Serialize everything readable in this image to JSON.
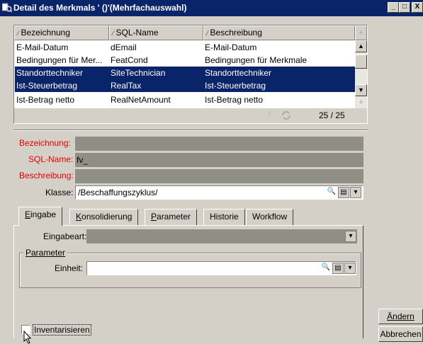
{
  "window": {
    "title": "Detail des Merkmals ' ()'(Mehrfachauswahl)",
    "buttons": [
      "_",
      "□",
      "X"
    ]
  },
  "list": {
    "columns": [
      "Bezeichnung",
      "SQL-Name",
      "Beschreibung"
    ],
    "rows": [
      {
        "name": "E-Mail-Datum",
        "sql": "dEmail",
        "desc": "E-Mail-Datum",
        "selected": false
      },
      {
        "name": "Bedingungen für Mer...",
        "sql": "FeatCond",
        "desc": "Bedingungen für Merkmale",
        "selected": false
      },
      {
        "name": "Standorttechniker",
        "sql": "SiteTechnician",
        "desc": "Standorttechniker",
        "selected": true
      },
      {
        "name": "Ist-Steuerbetrag",
        "sql": "RealTax",
        "desc": "Ist-Steuerbetrag",
        "selected": true
      },
      {
        "name": "Ist-Betrag netto",
        "sql": "RealNetAmount",
        "desc": "Ist-Betrag netto",
        "selected": false
      }
    ],
    "count": "25 / 25"
  },
  "form": {
    "bezeichnung_label": "Bezeichnung:",
    "bezeichnung_value": "",
    "sqlname_label": "SQL-Name:",
    "sqlname_value": "fv_",
    "beschreibung_label": "Beschreibung:",
    "beschreibung_value": "",
    "klasse_label": "Klasse:",
    "klasse_value": "/Beschaffungszyklus/"
  },
  "tabs": [
    {
      "label": "Eingabe",
      "underline": "E",
      "rest": "ingabe",
      "active": true
    },
    {
      "label": "Konsolidierung",
      "underline": "K",
      "rest": "onsolidierung",
      "active": false
    },
    {
      "label": "Parameter",
      "underline": "P",
      "rest": "arameter",
      "active": false
    },
    {
      "label": "Historie",
      "underline": "",
      "rest": "Historie",
      "active": false
    },
    {
      "label": "Workflow",
      "underline": "",
      "rest": "Workflow",
      "active": false
    }
  ],
  "eingabe": {
    "eingabeart_label": "Eingabeart:",
    "eingabeart_value": "",
    "parameter_group": "Parameter",
    "einheit_label": "Einheit:",
    "einheit_value": ""
  },
  "checkbox": {
    "label": "Inventarisieren",
    "checked": false
  },
  "buttons": {
    "andern": "Ändern",
    "abbrechen": "Abbrechen"
  }
}
